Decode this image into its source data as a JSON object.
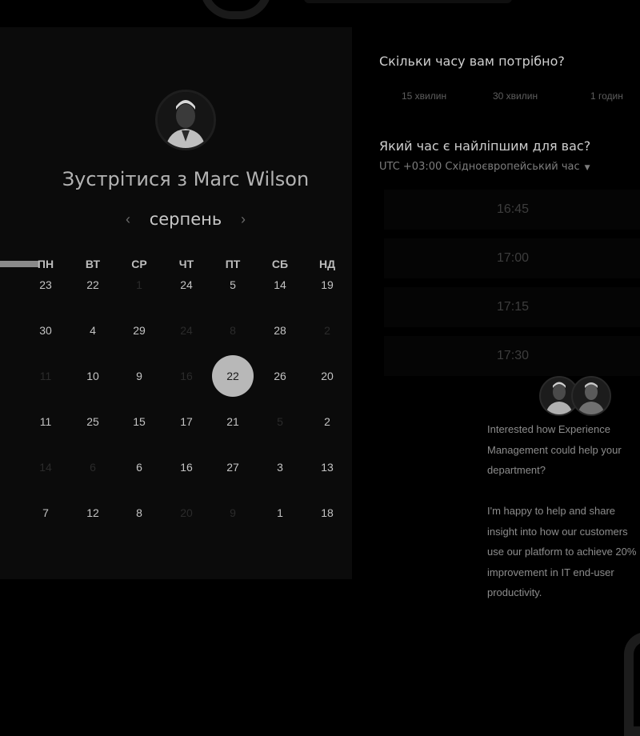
{
  "calendar": {
    "title": "Зустрітися з Marc Wilson",
    "month": "серпень",
    "prev_icon": "chevron-left-icon",
    "next_icon": "chevron-right-icon",
    "weekdays": [
      "ПН",
      "ВТ",
      "СР",
      "ЧТ",
      "ПТ",
      "СБ",
      "НД"
    ],
    "weeks": [
      [
        {
          "label": "23",
          "state": "active"
        },
        {
          "label": "22",
          "state": "active"
        },
        {
          "label": "1",
          "state": "muted"
        },
        {
          "label": "24",
          "state": "active"
        },
        {
          "label": "5",
          "state": "active"
        },
        {
          "label": "14",
          "state": "active"
        },
        {
          "label": "19",
          "state": "active"
        }
      ],
      [
        {
          "label": "30",
          "state": "active"
        },
        {
          "label": "4",
          "state": "active"
        },
        {
          "label": "29",
          "state": "active"
        },
        {
          "label": "24",
          "state": "muted"
        },
        {
          "label": "8",
          "state": "muted"
        },
        {
          "label": "28",
          "state": "active"
        },
        {
          "label": "2",
          "state": "muted"
        }
      ],
      [
        {
          "label": "11",
          "state": "muted"
        },
        {
          "label": "10",
          "state": "active"
        },
        {
          "label": "9",
          "state": "active"
        },
        {
          "label": "16",
          "state": "muted"
        },
        {
          "label": "22",
          "state": "selected"
        },
        {
          "label": "26",
          "state": "active"
        },
        {
          "label": "20",
          "state": "active"
        }
      ],
      [
        {
          "label": "11",
          "state": "active"
        },
        {
          "label": "25",
          "state": "active"
        },
        {
          "label": "15",
          "state": "active"
        },
        {
          "label": "17",
          "state": "active"
        },
        {
          "label": "21",
          "state": "active"
        },
        {
          "label": "5",
          "state": "muted"
        },
        {
          "label": "2",
          "state": "active"
        }
      ],
      [
        {
          "label": "14",
          "state": "muted"
        },
        {
          "label": "6",
          "state": "muted"
        },
        {
          "label": "6",
          "state": "active"
        },
        {
          "label": "16",
          "state": "active"
        },
        {
          "label": "27",
          "state": "active"
        },
        {
          "label": "3",
          "state": "active"
        },
        {
          "label": "13",
          "state": "active"
        }
      ],
      [
        {
          "label": "7",
          "state": "active"
        },
        {
          "label": "12",
          "state": "active"
        },
        {
          "label": "8",
          "state": "active"
        },
        {
          "label": "20",
          "state": "muted"
        },
        {
          "label": "9",
          "state": "muted"
        },
        {
          "label": "1",
          "state": "active"
        },
        {
          "label": "18",
          "state": "active"
        }
      ]
    ]
  },
  "booking": {
    "duration_heading": "Скільки часу вам потрібно?",
    "durations": [
      "15 хвилин",
      "30 хвилин",
      "1 годин"
    ],
    "time_heading": "Який час є найліпшим для вас?",
    "timezone": "UTC +03:00 Східноєвропейський час",
    "timezone_caret_icon": "caret-down-icon",
    "slots": [
      "16:45",
      "17:00",
      "17:15",
      "17:30"
    ]
  },
  "chat": {
    "message": "Interested how Experience Management could help your department?\n\nI'm happy to help and share insight into how our customers use our platform to achieve 20% improvement in IT end-user productivity."
  },
  "colors": {
    "background": "#000000",
    "panel": "#0b0b0b",
    "selected_day": "#b8b8b8"
  }
}
